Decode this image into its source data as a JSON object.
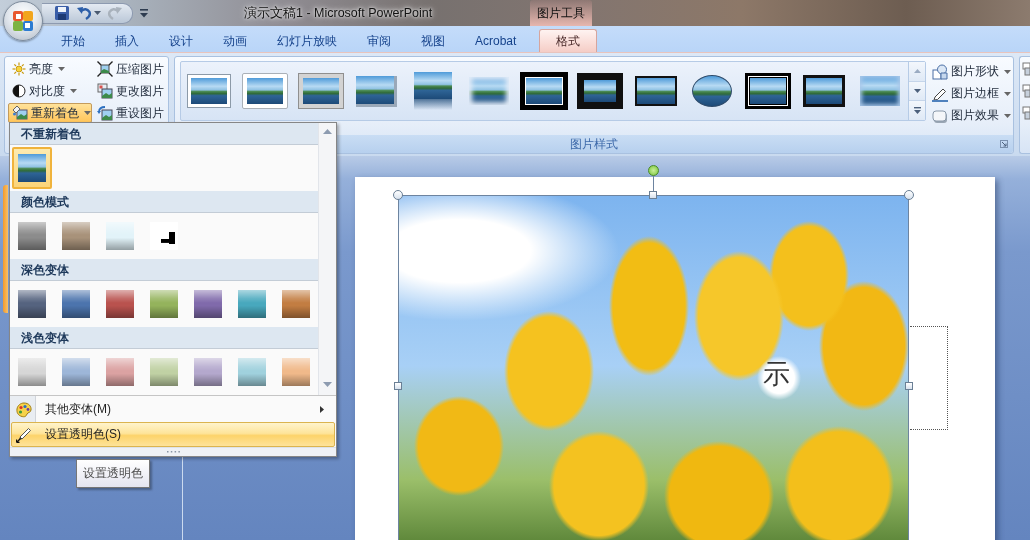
{
  "window": {
    "title": "演示文稿1 - Microsoft PowerPoint",
    "context_title": "图片工具"
  },
  "quick_access": [
    {
      "kind": "save",
      "disabled": false
    },
    {
      "kind": "undo",
      "disabled": false
    },
    {
      "kind": "undo-menu",
      "disabled": false
    },
    {
      "kind": "redo",
      "disabled": true
    },
    {
      "kind": "customize",
      "disabled": false
    }
  ],
  "tabs": [
    {
      "label": "开始",
      "selected": false
    },
    {
      "label": "插入",
      "selected": false
    },
    {
      "label": "设计",
      "selected": false
    },
    {
      "label": "动画",
      "selected": false
    },
    {
      "label": "幻灯片放映",
      "selected": false
    },
    {
      "label": "审阅",
      "selected": false
    },
    {
      "label": "视图",
      "selected": false
    },
    {
      "label": "Acrobat",
      "selected": false
    },
    {
      "label": "格式",
      "selected": true
    }
  ],
  "ribbon": {
    "adjust": {
      "buttons": [
        {
          "kind": "brightness",
          "label": "亮度",
          "dropdown": true,
          "open": false
        },
        {
          "kind": "contrast",
          "label": "对比度",
          "dropdown": true,
          "open": false
        },
        {
          "kind": "recolor",
          "label": "重新着色",
          "dropdown": true,
          "open": true
        },
        {
          "kind": "compress",
          "label": "压缩图片",
          "dropdown": false,
          "open": false
        },
        {
          "kind": "change",
          "label": "更改图片",
          "dropdown": false,
          "open": false
        },
        {
          "kind": "reset",
          "label": "重设图片",
          "dropdown": false,
          "open": false
        }
      ]
    },
    "picture_styles": {
      "label": "图片样式",
      "gallery": [
        {
          "kind": "thin-white",
          "selected": false
        },
        {
          "kind": "white",
          "selected": false
        },
        {
          "kind": "gray-frame",
          "selected": false
        },
        {
          "kind": "shadow",
          "selected": false
        },
        {
          "kind": "reflected",
          "selected": false
        },
        {
          "kind": "soft-edge",
          "selected": false
        },
        {
          "kind": "double-black",
          "selected": false
        },
        {
          "kind": "thick-black",
          "selected": false
        },
        {
          "kind": "thin-black",
          "selected": false
        },
        {
          "kind": "oval",
          "selected": false
        },
        {
          "kind": "double-frame",
          "selected": false
        },
        {
          "kind": "black-frame",
          "selected": false
        },
        {
          "kind": "glow",
          "selected": false
        }
      ],
      "commands": [
        {
          "kind": "shape",
          "label": "图片形状"
        },
        {
          "kind": "border",
          "label": "图片边框"
        },
        {
          "kind": "effects",
          "label": "图片效果"
        }
      ]
    }
  },
  "slides_pane": {
    "thumbnails": [
      {
        "selected": true
      }
    ]
  },
  "slide": {
    "title_fragment": "示",
    "picture_selected": true
  },
  "recolor_menu": {
    "sections": [
      {
        "title": "不重新着色",
        "items": [
          {
            "kind": "original",
            "selected": true
          }
        ]
      },
      {
        "title": "颜色模式",
        "items": [
          {
            "kind": "tint",
            "color": "#8c8c8c",
            "selected": false
          },
          {
            "kind": "tint",
            "color": "#a8927a",
            "selected": false
          },
          {
            "kind": "tint",
            "color": "#e2f3f9",
            "selected": false
          },
          {
            "kind": "silhouette",
            "selected": false
          }
        ]
      },
      {
        "title": "深色变体",
        "items": [
          {
            "kind": "tint",
            "color": "#55637f",
            "selected": false
          },
          {
            "kind": "tint",
            "color": "#4c74ad",
            "selected": false
          },
          {
            "kind": "tint",
            "color": "#b9524e",
            "selected": false
          },
          {
            "kind": "tint",
            "color": "#94b35c",
            "selected": false
          },
          {
            "kind": "tint",
            "color": "#806aab",
            "selected": false
          },
          {
            "kind": "tint",
            "color": "#48a8bd",
            "selected": false
          },
          {
            "kind": "tint",
            "color": "#c27d42",
            "selected": false
          }
        ]
      },
      {
        "title": "浅色变体",
        "items": [
          {
            "kind": "tint",
            "color": "#d6d6d6",
            "selected": false
          },
          {
            "kind": "tint",
            "color": "#9db6d8",
            "selected": false
          },
          {
            "kind": "tint",
            "color": "#dba2a2",
            "selected": false
          },
          {
            "kind": "tint",
            "color": "#c0d1a4",
            "selected": false
          },
          {
            "kind": "tint",
            "color": "#b4a8cd",
            "selected": false
          },
          {
            "kind": "tint",
            "color": "#a0d1dd",
            "selected": false
          },
          {
            "kind": "tint",
            "color": "#f0b98a",
            "selected": false
          }
        ]
      }
    ],
    "commands": [
      {
        "kind": "variants",
        "label": "其他变体(M)",
        "submenu": true,
        "highlighted": false
      },
      {
        "kind": "transparent",
        "label": "设置透明色(S)",
        "submenu": false,
        "highlighted": true
      }
    ],
    "tooltip": "设置透明色"
  }
}
